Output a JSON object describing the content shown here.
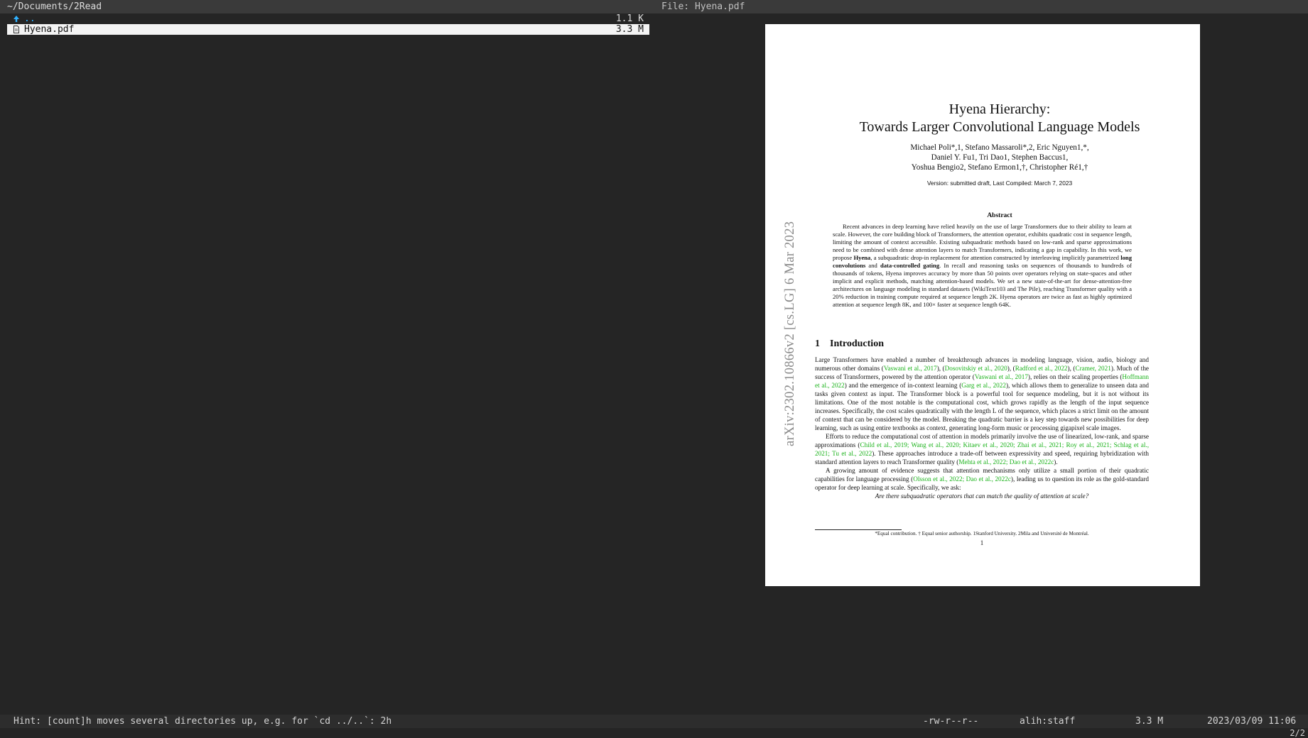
{
  "header": {
    "path": "~/Documents/2Read",
    "file_label": "File: Hyena.pdf"
  },
  "filelist": [
    {
      "icon": "arrow-up-icon",
      "name": "..",
      "size": "1.1 K"
    },
    {
      "icon": "pdf-file-icon",
      "name": "Hyena.pdf",
      "size": "3.3 M",
      "selected": true
    }
  ],
  "preview": {
    "arxiv_stamp": "arXiv:2302.10866v2  [cs.LG]  6 Mar 2023",
    "title_line1": "Hyena Hierarchy:",
    "title_line2": "Towards Larger Convolutional Language Models",
    "authors_line1": "Michael Poli*,1, Stefano Massaroli*,2, Eric Nguyen1,*,",
    "authors_line2": "Daniel Y. Fu1, Tri Dao1, Stephen Baccus1,",
    "authors_line3": "Yoshua Bengio2, Stefano Ermon1,†, Christopher Ré1,†",
    "version": "Version: submitted draft, Last Compiled: March 7, 2023",
    "abstract_heading": "Abstract",
    "abstract_p1": "Recent advances in deep learning have relied heavily on the use of large Transformers due to their ability to learn at scale. However, the core building block of Transformers, the attention operator, exhibits quadratic cost in sequence length, limiting the amount of context accessible. Existing subquadratic methods based on low-rank and sparse approximations need to be combined with dense attention layers to match Transformers, indicating a gap in capability. In this work, we propose ",
    "abstract_hyena": "Hyena",
    "abstract_p2": ", a subquadratic drop-in replacement for attention constructed by interleaving implicitly parametrized ",
    "abstract_longconv": "long convolutions",
    "abstract_p3": " and ",
    "abstract_gating": "data-controlled gating",
    "abstract_p4": ". In recall and reasoning tasks on sequences of thousands to hundreds of thousands of tokens, Hyena improves accuracy by more than 50 points over operators relying on state-spaces and other implicit and explicit methods, matching attention-based models. We set a new state-of-the-art for dense-attention-free architectures on language modeling in standard datasets (WikiText103 and The Pile), reaching Transformer quality with a 20% reduction in training compute required at sequence length 2K. Hyena operators are twice as fast as highly optimized attention at sequence length 8K, and 100× faster at sequence length 64K.",
    "intro_num": "1",
    "intro_title": "Introduction",
    "p1_a": "Large Transformers have enabled a number of breakthrough advances in modeling language, vision, audio, biology and numerous other domains (",
    "c1": "Vaswani et al., 2017",
    "p1_b": "), (",
    "c2": "Dosovitskiy et al., 2020",
    "p1_c": "), (",
    "c3": "Radford et al., 2022",
    "p1_d": "), (",
    "c4": "Cramer, 2021",
    "p1_e": "). Much of the success of Transformers, powered by the attention operator (",
    "c5": "Vaswani et al., 2017",
    "p1_f": "), relies on their scaling properties (",
    "c6": "Hoffmann et al., 2022",
    "p1_g": ") and the emergence of in-context learning (",
    "c7": "Garg et al., 2022",
    "p1_h": "), which allows them to generalize to unseen data and tasks given context as input. The Transformer block is a powerful tool for sequence modeling, but it is not without its limitations. One of the most notable is the computational cost, which grows rapidly as the length of the input sequence increases. Specifically, the cost scales quadratically with the length L of the sequence, which places a strict limit on the amount of context that can be considered by the model. Breaking the quadratic barrier is a key step towards new possibilities for deep learning, such as using entire textbooks as context, generating long-form music or processing gigapixel scale images.",
    "p2_a": "Efforts to reduce the computational cost of attention in models primarily involve the use of linearized, low-rank, and sparse approximations (",
    "c8": "Child et al., 2019; Wang et al., 2020; Kitaev et al., 2020; Zhai et al., 2021; Roy et al., 2021; Schlag et al., 2021; Tu et al., 2022",
    "p2_b": "). These approaches introduce a trade-off between expressivity and speed, requiring hybridization with standard attention layers to reach Transformer quality (",
    "c9": "Mehta et al., 2022; Dao et al., 2022c",
    "p2_c": ").",
    "p3_a": "A growing amount of evidence suggests that attention mechanisms only utilize a small portion of their quadratic capabilities for language processing (",
    "c10": "Olsson et al., 2022; Dao et al., 2022c",
    "p3_b": "), leading us to question its role as the gold-standard operator for deep learning at scale. Specifically, we ask:",
    "question": "Are there subquadratic operators that can match the quality of attention at scale?",
    "footnote": "*Equal contribution. † Equal senior authorship. 1Stanford University. 2Mila and Université de Montréal.",
    "page_number": "1"
  },
  "statusbar": {
    "hint": "Hint: [count]h moves several directories up, e.g. for `cd ../..`: 2h",
    "permissions": "-rw-r--r--",
    "owner": "alih:staff",
    "size": "3.3 M",
    "mtime": "2023/03/09 11:06",
    "position": "2/2"
  },
  "colors": {
    "background": "#252525",
    "selection": "#f4f4f4",
    "dir_up": "#2fb1ff",
    "citation": "#19b219"
  }
}
